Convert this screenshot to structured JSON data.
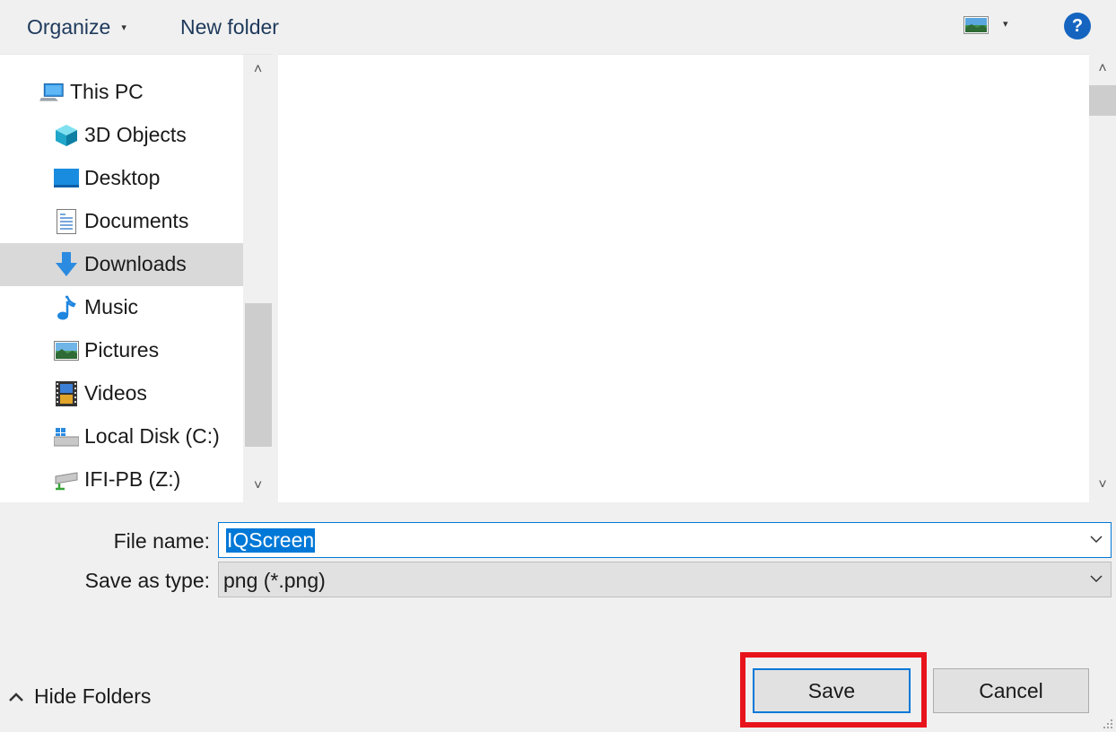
{
  "toolbar": {
    "organize_label": "Organize",
    "organize_caret": "▾",
    "new_folder_label": "New folder",
    "view_caret": "▾",
    "help_label": "?"
  },
  "nav": {
    "scroll_up": "˄",
    "scroll_down": "˅",
    "items": [
      {
        "label": "This PC",
        "icon": "computer-icon"
      },
      {
        "label": "3D Objects",
        "icon": "cube-icon"
      },
      {
        "label": "Desktop",
        "icon": "desktop-icon"
      },
      {
        "label": "Documents",
        "icon": "document-icon"
      },
      {
        "label": "Downloads",
        "icon": "download-arrow-icon",
        "selected": true
      },
      {
        "label": "Music",
        "icon": "music-note-icon"
      },
      {
        "label": "Pictures",
        "icon": "picture-icon"
      },
      {
        "label": "Videos",
        "icon": "film-icon"
      },
      {
        "label": "Local Disk (C:)",
        "icon": "drive-icon"
      },
      {
        "label": "IFI-PB (Z:)",
        "icon": "network-drive-icon"
      }
    ]
  },
  "content": {
    "scroll_up": "˄",
    "scroll_down": "˅"
  },
  "form": {
    "file_name_label": "File name:",
    "file_name_value": "IQScreen",
    "save_as_type_label": "Save as type:",
    "save_as_type_value": "png (*.png)"
  },
  "footer": {
    "hide_folders_label": "Hide Folders",
    "save_label": "Save",
    "cancel_label": "Cancel"
  },
  "colors": {
    "accent": "#0078d7",
    "highlight_box": "#e8141c",
    "help_blue": "#1565c0",
    "selected_row": "#d9d9d9"
  }
}
